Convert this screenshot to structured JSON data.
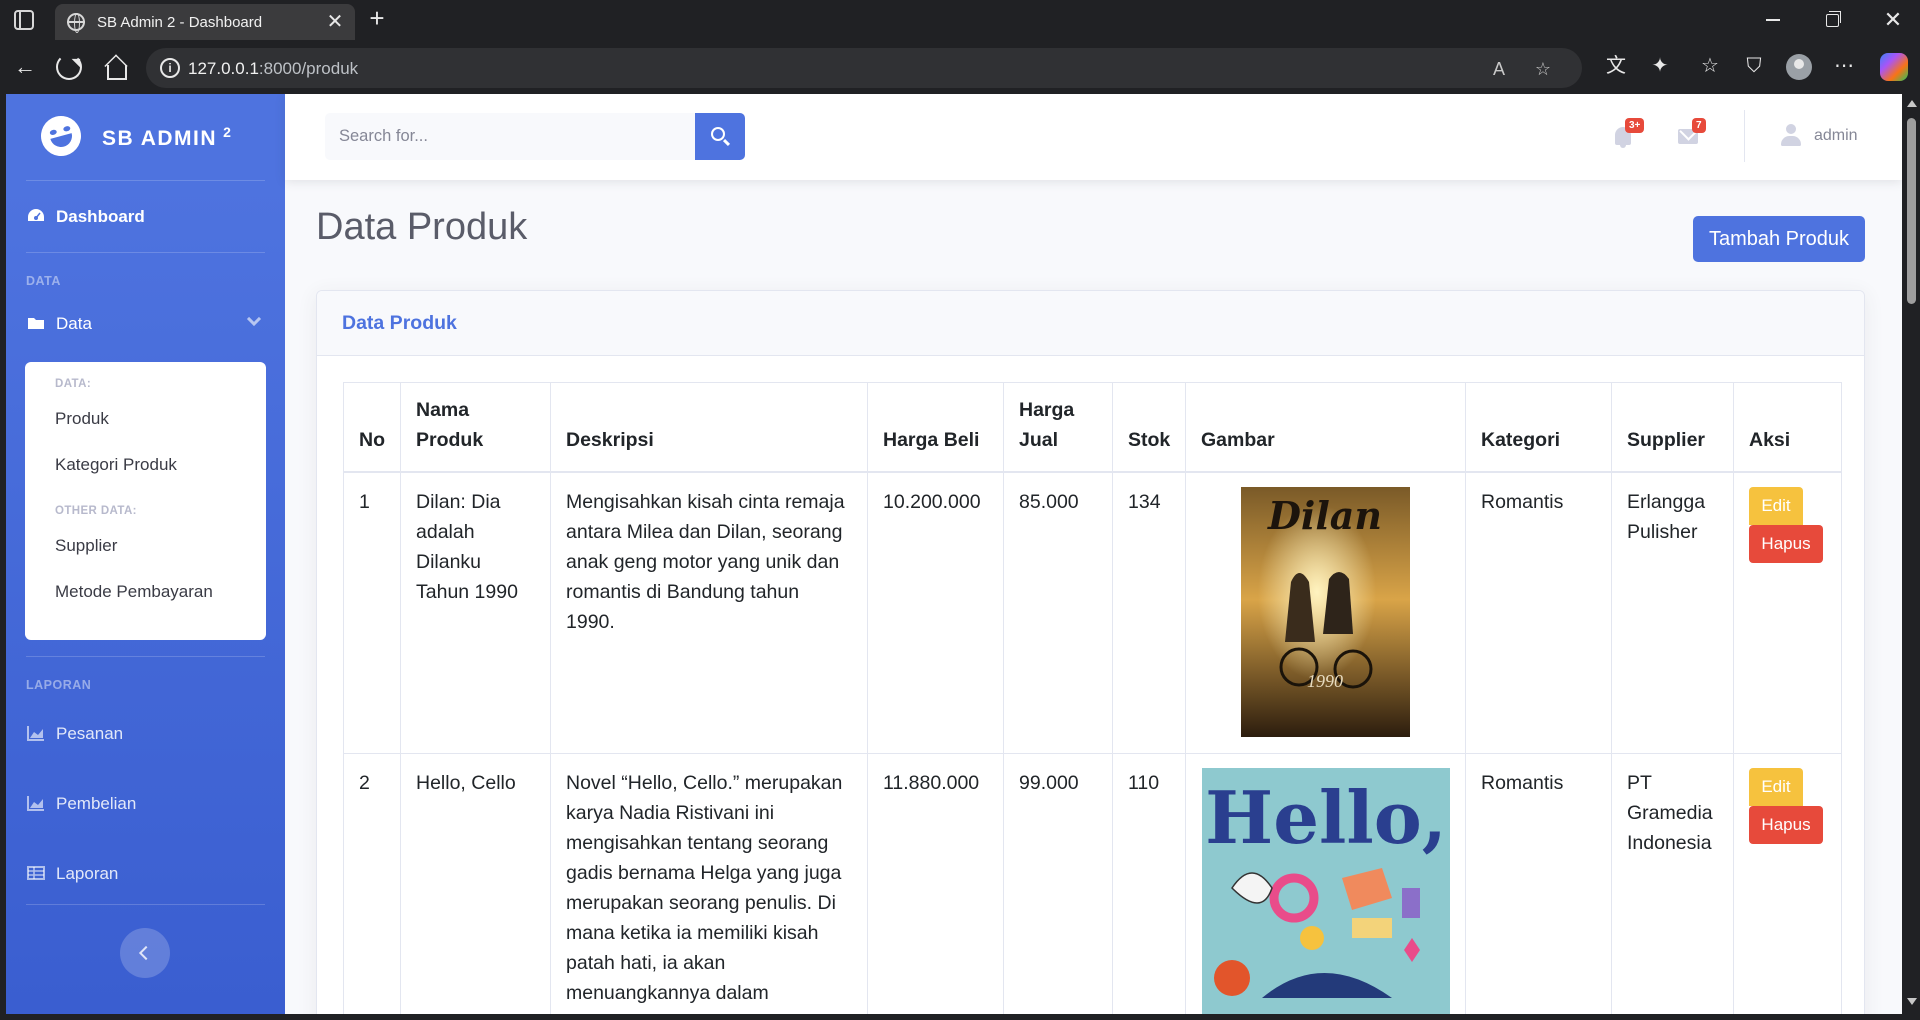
{
  "browser": {
    "tab_title": "SB Admin 2 - Dashboard",
    "url_host": "127.0.0.1",
    "url_path": ":8000/produk",
    "tab_close": "✕",
    "new_tab": "+",
    "window_close": "✕"
  },
  "sidebar": {
    "brand": "SB ADMIN",
    "brand_sup": "2",
    "dashboard": "Dashboard",
    "heading_data": "DATA",
    "data_menu": "Data",
    "collapse": {
      "heading_data": "DATA:",
      "items": [
        "Produk",
        "Kategori Produk"
      ],
      "heading_other": "OTHER DATA:",
      "other_items": [
        "Supplier",
        "Metode Pembayaran"
      ]
    },
    "heading_laporan": "LAPORAN",
    "laporan_items": [
      "Pesanan",
      "Pembelian",
      "Laporan"
    ]
  },
  "topbar": {
    "search_placeholder": "Search for...",
    "alerts_badge": "3+",
    "messages_badge": "7",
    "user_name": "admin"
  },
  "page": {
    "title": "Data Produk",
    "add_button": "Tambah Produk",
    "card_title": "Data Produk"
  },
  "table": {
    "headers": [
      "No",
      "Nama Produk",
      "Deskripsi",
      "Harga Beli",
      "Harga Jual",
      "Stok",
      "Gambar",
      "Kategori",
      "Supplier",
      "Aksi"
    ],
    "rows": [
      {
        "no": "1",
        "nama": "Dilan: Dia adalah Dilanku Tahun 1990",
        "deskripsi": "Mengisahkan kisah cinta remaja antara Milea dan Dilan, seorang anak geng motor yang unik dan romantis di Bandung tahun 1990.",
        "harga_beli": "10.200.000",
        "harga_jual": "85.000",
        "stok": "134",
        "cover_text": "Dilan",
        "cover_subtext": "1990",
        "kategori": "Romantis",
        "supplier": "Erlangga Pulisher",
        "edit": "Edit",
        "hapus": "Hapus"
      },
      {
        "no": "2",
        "nama": "Hello, Cello",
        "deskripsi": "Novel “Hello, Cello.” merupakan karya Nadia Ristivani ini mengisahkan tentang seorang gadis bernama Helga yang juga merupakan seorang penulis. Di mana ketika ia memiliki kisah patah hati, ia akan menuangkannya dalam",
        "harga_beli": "11.880.000",
        "harga_jual": "99.000",
        "stok": "110",
        "cover_text": "Hello,",
        "kategori": "Romantis",
        "supplier": "PT Gramedia Indonesia",
        "edit": "Edit",
        "hapus": "Hapus"
      }
    ]
  },
  "colors": {
    "primary": "#4e73df",
    "warning": "#f6c23e",
    "danger": "#e74a3b",
    "page_bg": "#f8f9fc"
  }
}
